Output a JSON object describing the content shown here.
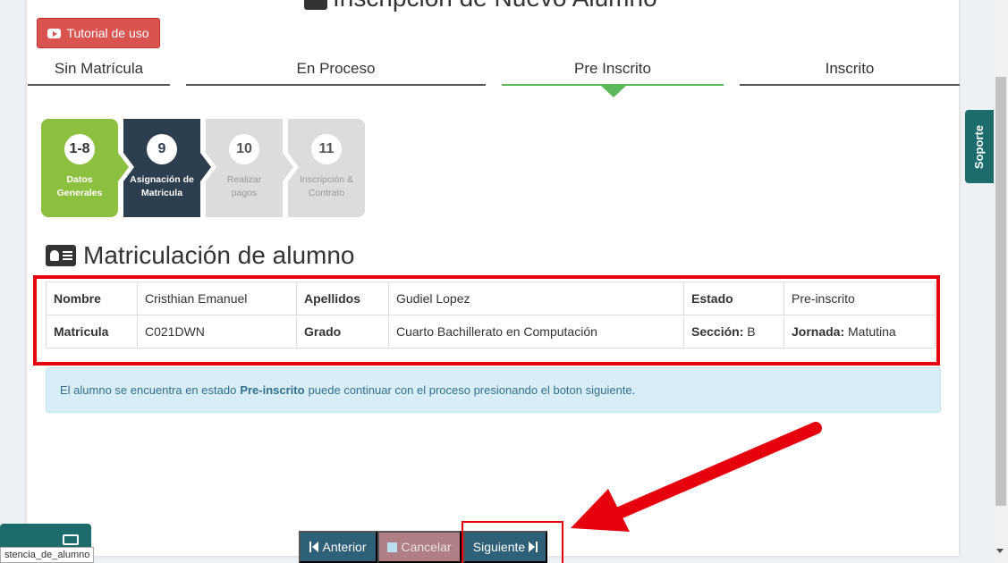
{
  "header": {
    "title": "Inscripción de Nuevo Alumno",
    "tutorial_label": "Tutorial de uso"
  },
  "tabs": [
    {
      "label": "Sin Matrícula"
    },
    {
      "label": "En Proceso"
    },
    {
      "label": "Pre Inscrito"
    },
    {
      "label": "Inscrito"
    }
  ],
  "steps": [
    {
      "num": "1-8",
      "label": "Datos Generales"
    },
    {
      "num": "9",
      "label": "Asignación de Matricula"
    },
    {
      "num": "10",
      "label": "Realizar pagos"
    },
    {
      "num": "11",
      "label": "Inscripción & Contrato"
    }
  ],
  "section": {
    "title": "Matriculación de alumno"
  },
  "info": {
    "nombre_label": "Nombre",
    "nombre": "Cristhian Emanuel",
    "apellidos_label": "Apellidos",
    "apellidos": "Gudiel Lopez",
    "estado_label": "Estado",
    "estado": "Pre-inscrito",
    "matricula_label": "Matricula",
    "matricula": "C021DWN",
    "grado_label": "Grado",
    "grado": "Cuarto Bachillerato en Computación",
    "seccion_label": "Sección:",
    "seccion": "B",
    "jornada_label": "Jornada:",
    "jornada": "Matutina"
  },
  "alert": {
    "before": "El alumno se encuentra en estado",
    "status": "Pre-inscrito",
    "after": "puede continuar con el proceso presionando el boton siguiente."
  },
  "buttons": {
    "prev": "Anterior",
    "cancel": "Cancelar",
    "next": "Siguiente"
  },
  "soporte": "Soporte",
  "status_url": "stencia_de_alumno",
  "colors": {
    "tab_active": "#5cb85c",
    "step_done": "#8dc03f",
    "step_current": "#2d3e4e",
    "step_pending": "#dcdcdc",
    "highlight": "#e6000d",
    "primary_button": "#2e6077"
  }
}
